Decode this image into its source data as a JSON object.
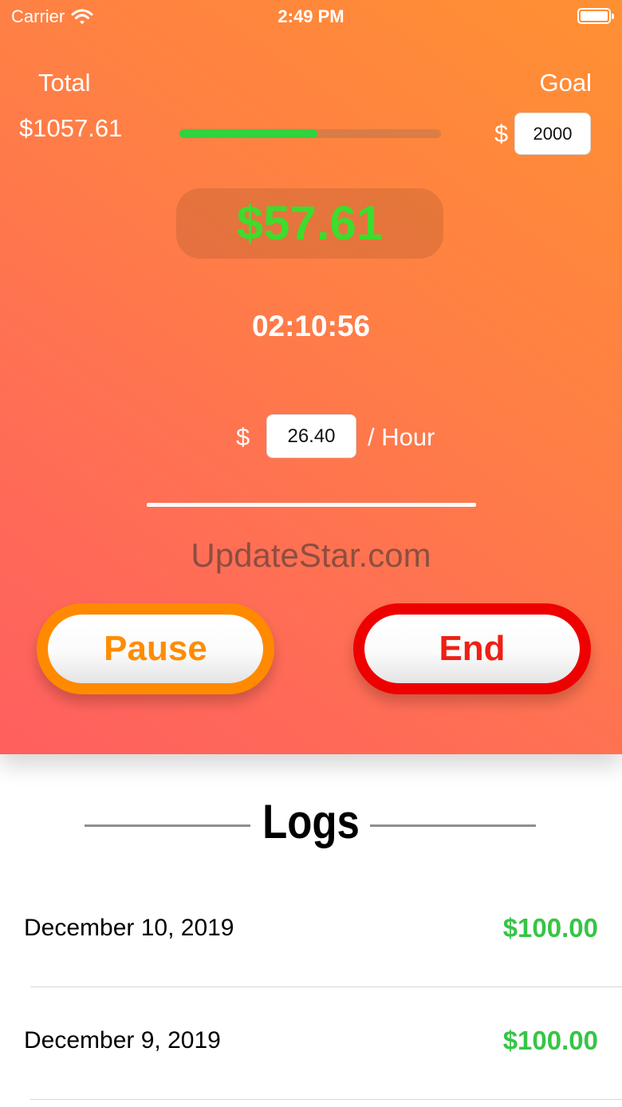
{
  "status_bar": {
    "carrier": "Carrier",
    "time": "2:49 PM"
  },
  "summary": {
    "total_label": "Total",
    "total_value": "$1057.61",
    "goal_label": "Goal",
    "goal_currency": "$",
    "goal_value": "2000",
    "goal_progress": 0.5288
  },
  "session": {
    "earned": "$57.61",
    "elapsed": "02:10:56",
    "rate_currency": "$",
    "rate_value": "26.40",
    "rate_unit": "/ Hour"
  },
  "watermark": "UpdateStar.com",
  "controls": {
    "pause_label": "Pause",
    "end_label": "End"
  },
  "logs": {
    "title": "Logs",
    "entries": [
      {
        "date": "December 10, 2019",
        "amount": "$100.00"
      },
      {
        "date": "December 9, 2019",
        "amount": "$100.00"
      }
    ]
  },
  "colors": {
    "gradient_start": "#ff5f5f",
    "gradient_end": "#ff9032",
    "progress": "#2fd33d",
    "earned": "#3ddc2d",
    "pause": "#ff8a00",
    "end": "#ee0000",
    "log_amount": "#36c546"
  }
}
